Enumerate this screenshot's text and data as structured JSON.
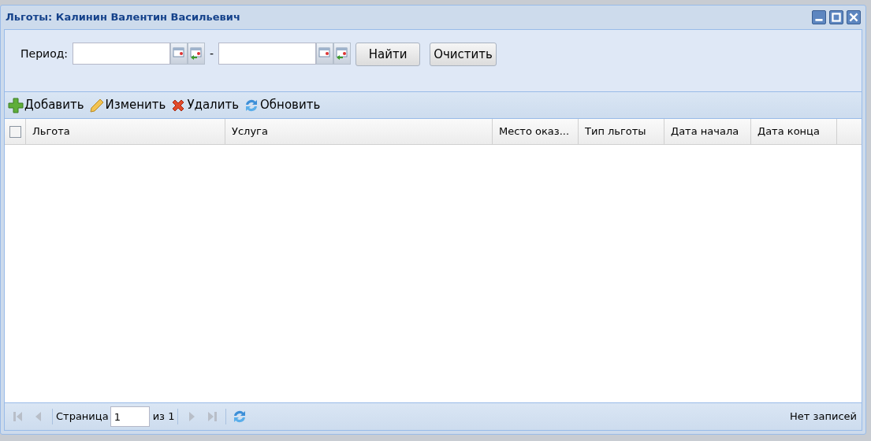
{
  "window": {
    "title": "Льготы: Калинин Валентин Васильевич",
    "controls": [
      {
        "kind": "minimize"
      },
      {
        "kind": "maximize"
      },
      {
        "kind": "close"
      }
    ]
  },
  "filter": {
    "label": "Период:",
    "separator": "-",
    "buttons": [
      "Найти",
      "Очистить"
    ]
  },
  "toolbar": [
    {
      "kind": "add",
      "label": "Добавить"
    },
    {
      "kind": "edit",
      "label": "Изменить"
    },
    {
      "kind": "delete",
      "label": "Удалить"
    },
    {
      "kind": "refresh",
      "label": "Обновить"
    }
  ],
  "table": {
    "select_all": {
      "checked": false
    },
    "columns": [
      "Льгота",
      "Услуга",
      "Место оказ...",
      "Тип льготы",
      "Дата начала",
      "Дата конца"
    ]
  },
  "pager": {
    "nav": [
      {
        "kind": "first",
        "disabled": true
      },
      {
        "kind": "prev",
        "disabled": true
      },
      {
        "kind": "next",
        "disabled": true
      },
      {
        "kind": "last",
        "disabled": true
      }
    ],
    "page_label": "Страница",
    "page_value": "1",
    "of_label": "из 1",
    "status": "Нет записей"
  }
}
